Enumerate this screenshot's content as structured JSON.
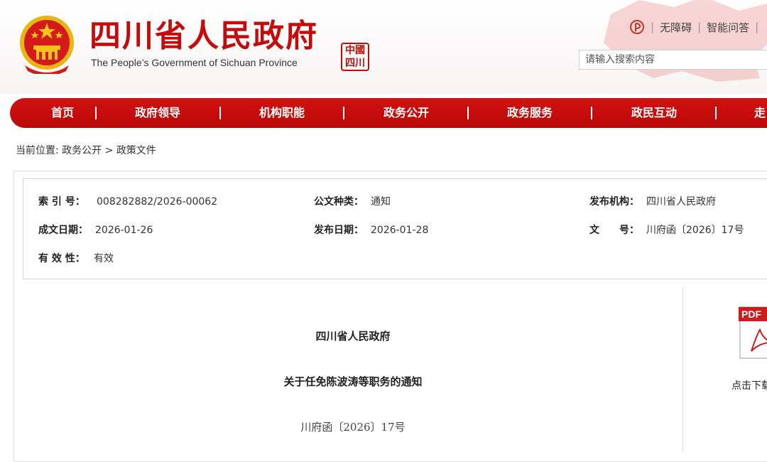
{
  "header": {
    "title_cn": "四川省人民政府",
    "title_en": "The People’s Government of Sichuan Province",
    "seal_chars": [
      "中",
      "國",
      "四",
      "川"
    ],
    "top_links": [
      "无障碍",
      "智能问答"
    ],
    "search_placeholder": "请输入搜索内容"
  },
  "nav": {
    "items": [
      "首页",
      "政府领导",
      "机构职能",
      "政务公开",
      "政务服务",
      "政民互动",
      "走"
    ]
  },
  "breadcrumb": {
    "prefix": "当前位置:",
    "items": [
      "政务公开",
      "政策文件"
    ],
    "separator": ">"
  },
  "meta": {
    "index_no": {
      "label": "索 引 号：",
      "value": "008282882/2026-00062"
    },
    "doc_type": {
      "label": "公文种类：",
      "value": "通知"
    },
    "issuer": {
      "label": "发布机构：",
      "value": "四川省人民政府"
    },
    "created_date": {
      "label": "成文日期：",
      "value": "2026-01-26"
    },
    "publish_date": {
      "label": "发布日期：",
      "value": "2026-01-28"
    },
    "doc_no": {
      "label": "文　　号：",
      "value": "川府函〔2026〕17号"
    },
    "validity": {
      "label": "有 效 性：",
      "value": "有效"
    }
  },
  "document": {
    "org": "四川省人民政府",
    "title": "关于任免陈波涛等职务的通知",
    "number": "川府函〔2026〕17号"
  },
  "sidebar": {
    "pdf_label": "PDF",
    "download_text": "点击下载"
  },
  "colors": {
    "brand_red": "#c40a0a",
    "nav_red": "#c80d0d"
  }
}
